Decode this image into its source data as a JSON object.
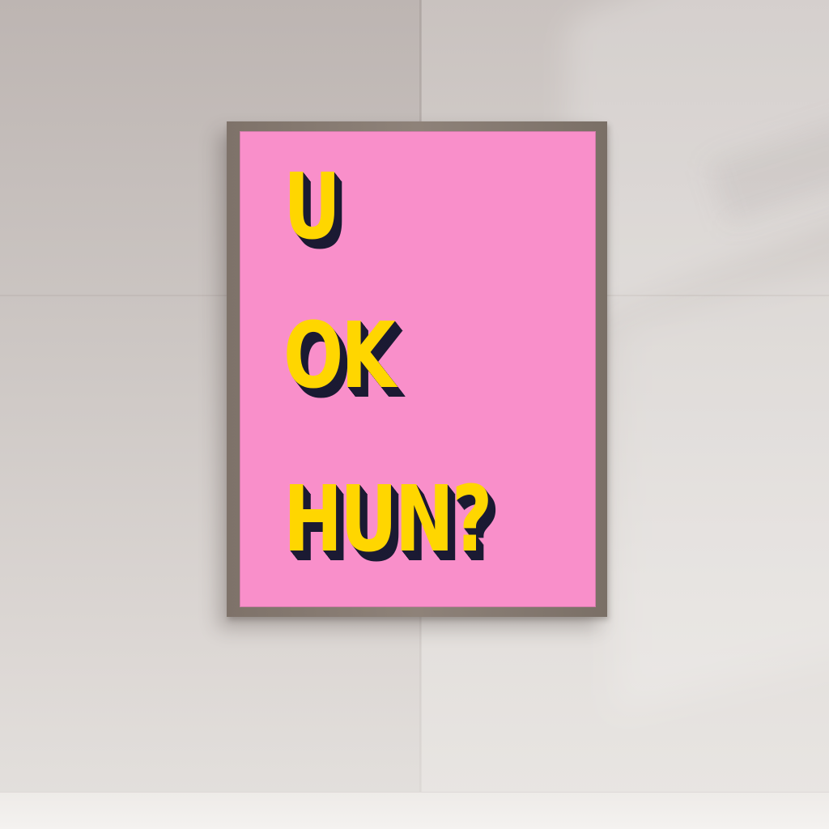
{
  "poster": {
    "lines": [
      "U",
      "OK",
      "HUN?"
    ]
  },
  "colors": {
    "poster_background": "#f98fca",
    "text_fill": "#ffd600",
    "text_shadow": "#1b1a33",
    "frame": "#857970",
    "wall": "#d6d1ce"
  }
}
